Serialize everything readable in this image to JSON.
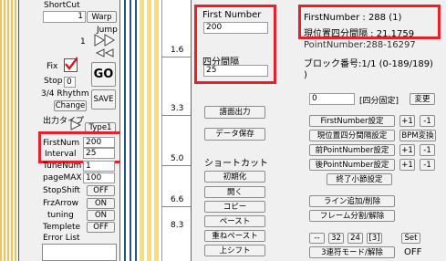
{
  "left_panel": {
    "shortcut_label": "ShortCut",
    "shortcut_value": "1",
    "warp_button": "Warp",
    "jump_label": "Jump",
    "jump_value": "1",
    "fix_label": "Fix",
    "go_button": "GO",
    "stop_label": "Stop",
    "stop_value": "0",
    "rhythm_label": "3/4 Rhythm",
    "change_button": "Change",
    "save_button": "SAVE",
    "output_type_label": "出力タイプ",
    "output_type_value": "Type1",
    "first_num_label": "FirstNum",
    "first_num_value": "200",
    "interval_label": "Interval",
    "interval_value": "25",
    "tune_num_label": "TuneNum",
    "tune_num_value": "1",
    "page_max_label": "pageMAX",
    "page_max_value": "100",
    "toggles": [
      {
        "label": "StopShift",
        "value": "OFF"
      },
      {
        "label": "FrzArrow",
        "value": "ON"
      },
      {
        "label": "tuning",
        "value": "ON"
      },
      {
        "label": "Templete",
        "value": "OFF"
      }
    ],
    "error_list_label": "Error List"
  },
  "chart_area": {
    "measure_labels": [
      "1.6",
      "3.3",
      "5.0",
      "6.6",
      "8.3"
    ]
  },
  "right_panel": {
    "first_number_label": "First Number",
    "first_number_value": "200",
    "interval_label": "四分間隔",
    "interval_value": "25",
    "info_lines": [
      "FirstNumber : 288 (1)",
      "現位置四分間隔 : 21.1759",
      "PointNumber:288-16297",
      "ブロック番号:1/1 (0-189/189)",
      ")"
    ],
    "score_output_button": "譜面出力",
    "data_save_button": "データ保存",
    "shortcut_heading": "ショートカット",
    "shortcut_buttons": [
      "初期化",
      "開く",
      "コピー",
      "ペースト",
      "重ねペースト",
      "上シフト"
    ],
    "fixed_value": "0",
    "fixed_label": "[四分固定]",
    "change_button": "変更",
    "setting_rows": [
      {
        "label": "FirstNumber設定",
        "plus": "+1",
        "minus": "-1"
      },
      {
        "label": "現位置四分間隔設定",
        "extra": "BPM変換"
      },
      {
        "label": "前PointNumber設定",
        "plus": "+1",
        "minus": "-1"
      },
      {
        "label": "後PointNumber設定",
        "plus": "+1",
        "minus": "-1"
      }
    ],
    "end_measure_button": "終了小節設定",
    "line_add_button": "ライン追加/削除",
    "frame_split_button": "フレーム分割/解除",
    "division_buttons": [
      "--",
      "32",
      "24",
      "[3]"
    ],
    "set_button": "Set",
    "triplet_button": "3連符モード/解除",
    "triplet_status": "OFF"
  },
  "colors": {
    "highlight_border": "#e8202a",
    "lane_yellow": "#f5e07a",
    "lane_blue": "#2e4f86",
    "check_red": "#d81a1a"
  }
}
